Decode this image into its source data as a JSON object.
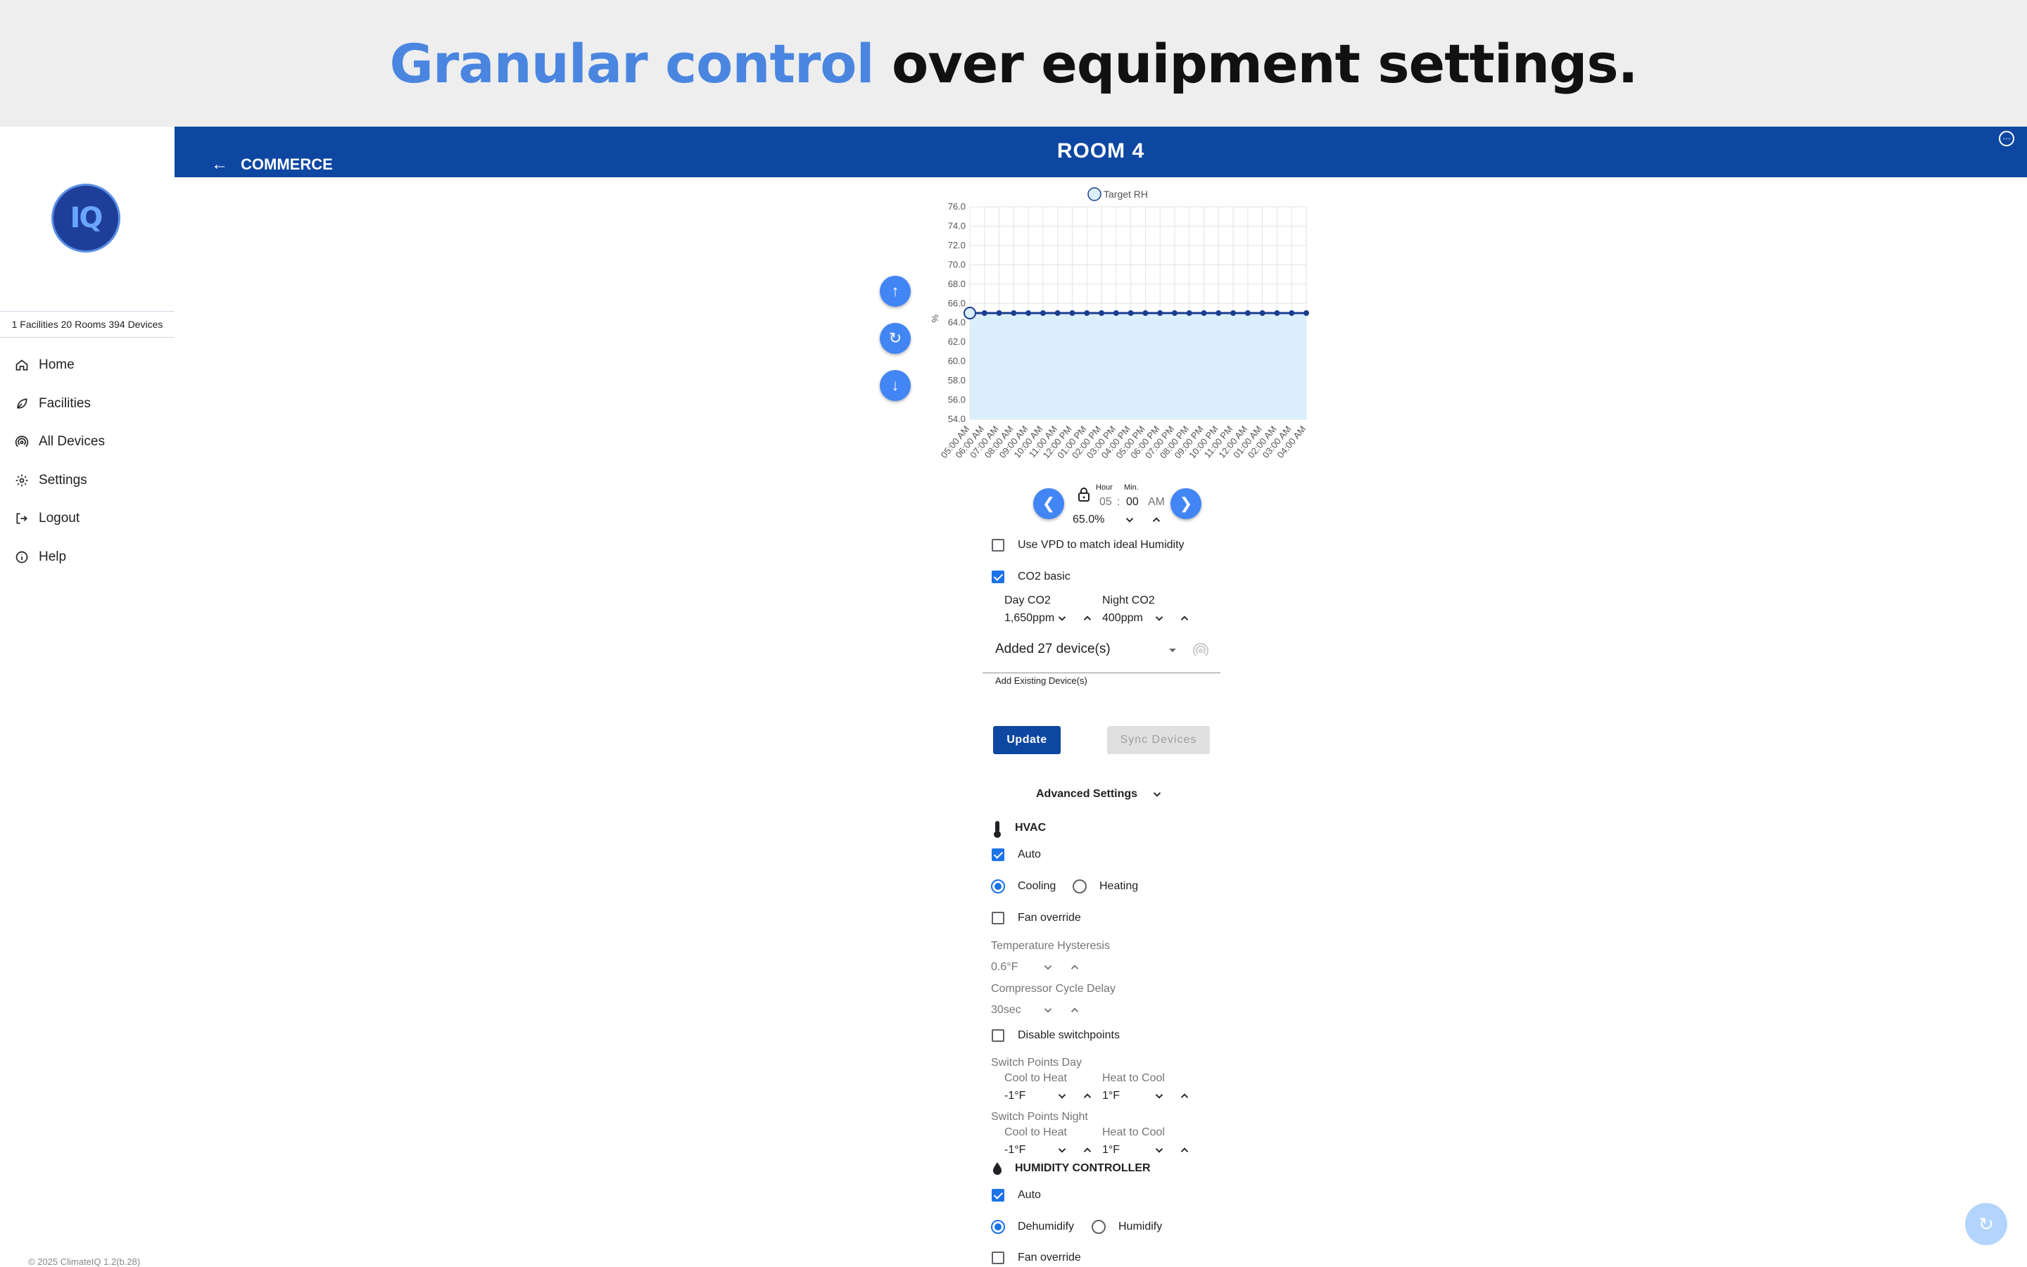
{
  "banner": {
    "highlight": "Granular control",
    "rest": "over equipment settings."
  },
  "sidebar": {
    "logo_text": "IQ",
    "counts": "1 Facilities 20 Rooms 394 Devices",
    "items": [
      {
        "label": "Home",
        "icon": "home-icon"
      },
      {
        "label": "Facilities",
        "icon": "leaf-icon"
      },
      {
        "label": "All Devices",
        "icon": "wireless-icon"
      },
      {
        "label": "Settings",
        "icon": "gear-icon"
      },
      {
        "label": "Logout",
        "icon": "logout-icon"
      },
      {
        "label": "Help",
        "icon": "info-icon"
      }
    ],
    "footer": "© 2025 ClimateIQ 1.2(b.28)"
  },
  "header": {
    "back_label": "COMMERCE",
    "title": "ROOM 4"
  },
  "chart_data": {
    "type": "line",
    "legend": "Target RH",
    "ylabel": "%",
    "ylim": [
      54,
      76
    ],
    "yticks": [
      "76.0",
      "74.0",
      "72.0",
      "70.0",
      "68.0",
      "66.0",
      "64.0",
      "62.0",
      "60.0",
      "58.0",
      "56.0",
      "54.0"
    ],
    "categories": [
      "05:00 AM",
      "06:00 AM",
      "07:00 AM",
      "08:00 AM",
      "09:00 AM",
      "10:00 AM",
      "11:00 AM",
      "12:00 PM",
      "01:00 PM",
      "02:00 PM",
      "03:00 PM",
      "04:00 PM",
      "05:00 PM",
      "06:00 PM",
      "07:00 PM",
      "08:00 PM",
      "09:00 PM",
      "10:00 PM",
      "11:00 PM",
      "12:00 AM",
      "01:00 AM",
      "02:00 AM",
      "03:00 AM",
      "04:00 AM"
    ],
    "series": [
      {
        "name": "Target RH",
        "values": [
          65,
          65,
          65,
          65,
          65,
          65,
          65,
          65,
          65,
          65,
          65,
          65,
          65,
          65,
          65,
          65,
          65,
          65,
          65,
          65,
          65,
          65,
          65,
          65
        ]
      }
    ],
    "colors": {
      "line": "#1a3d8f",
      "fill": "#dbeefb"
    }
  },
  "time": {
    "hour_label": "Hour",
    "min_label": "Min.",
    "hour": "05",
    "sep": ":",
    "minute": "00",
    "ampm": "AM",
    "value": "65.0%"
  },
  "options": {
    "vpd_label": "Use VPD to match ideal Humidity",
    "co2_label": "CO2 basic",
    "day_co2_label": "Day CO2",
    "day_co2_value": "1,650ppm",
    "night_co2_label": "Night CO2",
    "night_co2_value": "400ppm"
  },
  "devices": {
    "selected": "Added 27 device(s)",
    "helper": "Add Existing Device(s)"
  },
  "buttons": {
    "update": "Update",
    "sync": "Sync Devices"
  },
  "advanced": {
    "title": "Advanced Settings",
    "hvac": {
      "title": "HVAC",
      "auto": "Auto",
      "cooling": "Cooling",
      "heating": "Heating",
      "fan_override": "Fan override",
      "temp_hyst_label": "Temperature Hysteresis",
      "temp_hyst_value": "0.6°F",
      "comp_delay_label": "Compressor Cycle Delay",
      "comp_delay_value": "30sec",
      "disable_switchpoints": "Disable switchpoints",
      "sp_day": "Switch Points Day",
      "sp_night": "Switch Points Night",
      "cool_to_heat": "Cool to Heat",
      "heat_to_cool": "Heat to Cool",
      "day_c2h": "-1°F",
      "day_h2c": "1°F",
      "night_c2h": "-1°F",
      "night_h2c": "1°F"
    },
    "humidity": {
      "title": "HUMIDITY CONTROLLER",
      "auto": "Auto",
      "dehumidify": "Dehumidify",
      "humidify": "Humidify",
      "fan_override": "Fan override"
    }
  }
}
